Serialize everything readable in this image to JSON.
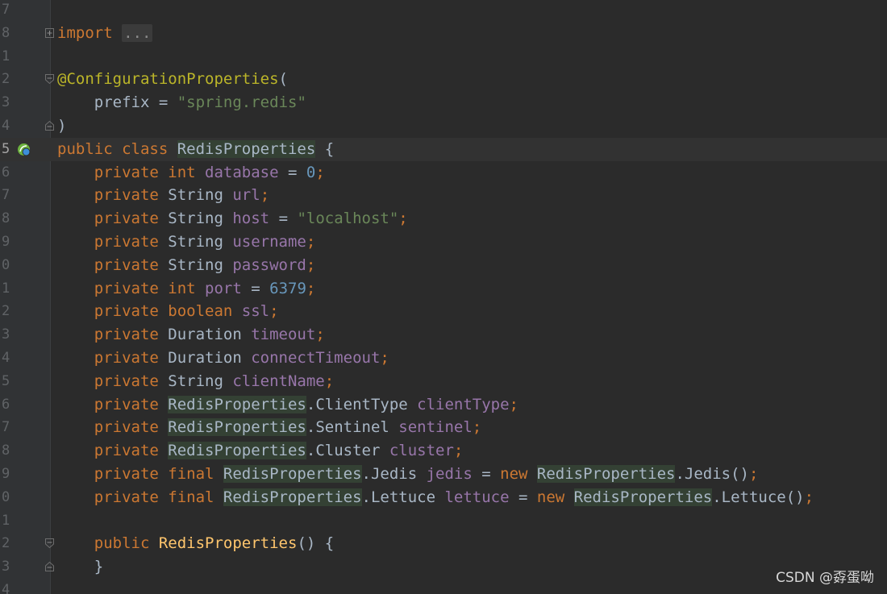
{
  "watermark": "CSDN @孬蛋呦",
  "lines": [
    {
      "num": "7"
    },
    {
      "num": "8",
      "t": {
        "kw_import": "import",
        "collapsed": "..."
      }
    },
    {
      "num": "1"
    },
    {
      "num": "2",
      "t": {
        "annotation": "@ConfigurationProperties",
        "open": "("
      }
    },
    {
      "num": "3",
      "t": {
        "attr": "prefix",
        "eq": " = ",
        "value": "\"spring.redis\""
      }
    },
    {
      "num": "4",
      "t": {
        "close": ")"
      }
    },
    {
      "num": "5",
      "t": {
        "kw": "public class ",
        "name": "RedisProperties",
        "brace": " {"
      }
    },
    {
      "num": "6",
      "t": {
        "kw": "private int ",
        "field": "database",
        "eq": " = ",
        "val": "0",
        "semi": ";"
      }
    },
    {
      "num": "7",
      "t": {
        "kw": "private ",
        "type": "String ",
        "field": "url",
        "semi": ";"
      }
    },
    {
      "num": "8",
      "t": {
        "kw": "private ",
        "type": "String ",
        "field": "host",
        "eq": " = ",
        "val": "\"localhost\"",
        "semi": ";"
      }
    },
    {
      "num": "9",
      "t": {
        "kw": "private ",
        "type": "String ",
        "field": "username",
        "semi": ";"
      }
    },
    {
      "num": "0",
      "t": {
        "kw": "private ",
        "type": "String ",
        "field": "password",
        "semi": ";"
      }
    },
    {
      "num": "1",
      "t": {
        "kw": "private int ",
        "field": "port",
        "eq": " = ",
        "val": "6379",
        "semi": ";"
      }
    },
    {
      "num": "2",
      "t": {
        "kw": "private boolean ",
        "field": "ssl",
        "semi": ";"
      }
    },
    {
      "num": "3",
      "t": {
        "kw": "private ",
        "type": "Duration ",
        "field": "timeout",
        "semi": ";"
      }
    },
    {
      "num": "4",
      "t": {
        "kw": "private ",
        "type": "Duration ",
        "field": "connectTimeout",
        "semi": ";"
      }
    },
    {
      "num": "5",
      "t": {
        "kw": "private ",
        "type": "String ",
        "field": "clientName",
        "semi": ";"
      }
    },
    {
      "num": "6",
      "t": {
        "kw": "private ",
        "cls": "RedisProperties",
        "inner": ".ClientType ",
        "field": "clientType",
        "semi": ";"
      }
    },
    {
      "num": "7",
      "t": {
        "kw": "private ",
        "cls": "RedisProperties",
        "inner": ".Sentinel ",
        "field": "sentinel",
        "semi": ";"
      }
    },
    {
      "num": "8",
      "t": {
        "kw": "private ",
        "cls": "RedisProperties",
        "inner": ".Cluster ",
        "field": "cluster",
        "semi": ";"
      }
    },
    {
      "num": "9",
      "t": {
        "kw": "private final ",
        "cls": "RedisProperties",
        "inner": ".Jedis ",
        "field": "jedis",
        "eq": " = ",
        "kwnew": "new ",
        "cls2": "RedisProperties",
        "inner2": ".Jedis()",
        "semi": ";"
      }
    },
    {
      "num": "0",
      "t": {
        "kw": "private final ",
        "cls": "RedisProperties",
        "inner": ".Lettuce ",
        "field": "lettuce",
        "eq": " = ",
        "kwnew": "new ",
        "cls2": "RedisProperties",
        "inner2": ".Lettuce()",
        "semi": ";"
      }
    },
    {
      "num": "1"
    },
    {
      "num": "2",
      "t": {
        "kw": "public ",
        "method": "RedisProperties",
        "paren": "() {"
      }
    },
    {
      "num": "3",
      "t": {
        "close": "}"
      }
    },
    {
      "num": "4"
    }
  ]
}
